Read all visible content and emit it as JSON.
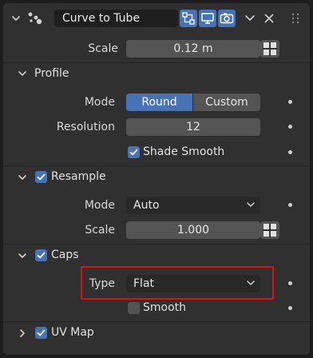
{
  "header": {
    "name": "Curve to Tube",
    "icons": [
      "realtime-toggle-icon",
      "viewport-display-icon",
      "render-camera-icon"
    ]
  },
  "top": {
    "scale_label": "Scale",
    "scale_value": "0.12 m"
  },
  "profile": {
    "title": "Profile",
    "mode_label": "Mode",
    "mode_options": [
      "Round",
      "Custom"
    ],
    "mode_selected": "Round",
    "resolution_label": "Resolution",
    "resolution_value": "12",
    "shade_smooth_label": "Shade Smooth",
    "shade_smooth_checked": true
  },
  "resample": {
    "title": "Resample",
    "enabled": true,
    "mode_label": "Mode",
    "mode_value": "Auto",
    "scale_label": "Scale",
    "scale_value": "1.000"
  },
  "caps": {
    "title": "Caps",
    "enabled": true,
    "type_label": "Type",
    "type_value": "Flat",
    "smooth_label": "Smooth",
    "smooth_checked": false
  },
  "uvmap": {
    "title": "UV Map",
    "enabled": true
  },
  "colors": {
    "accent": "#4772b3",
    "panel": "#303030",
    "field": "#545454",
    "dropdown": "#282828",
    "highlight": "#e01010"
  }
}
